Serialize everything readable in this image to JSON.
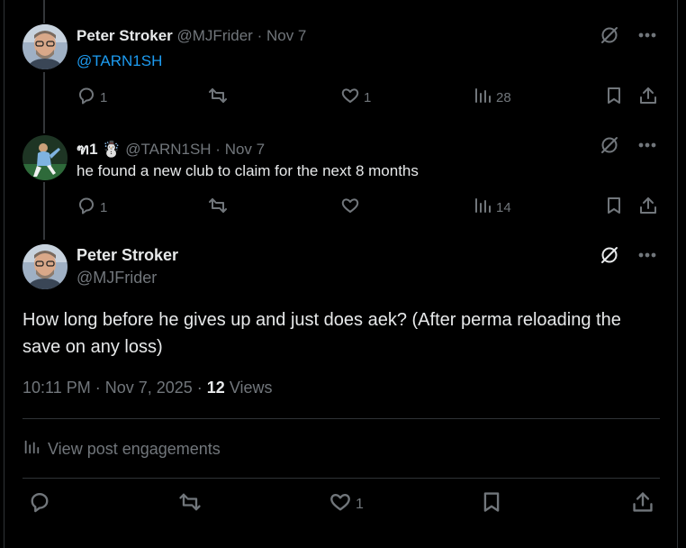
{
  "posts": [
    {
      "name": "Peter Stroker",
      "handle": "@MJFrider",
      "sep": "·",
      "date": "Nov 7",
      "text_mention": "@TARN1SH",
      "replies": "1",
      "reposts": "",
      "likes": "1",
      "views": "28"
    },
    {
      "name": "ฑ1",
      "emoji": "☃️",
      "handle": "@TARN1SH",
      "sep": "·",
      "date": "Nov 7",
      "text": "he found a new club to claim for the next 8 months",
      "replies": "1",
      "reposts": "",
      "likes": "",
      "views": "14"
    }
  ],
  "main": {
    "name": "Peter Stroker",
    "handle": "@MJFrider",
    "text": "How long before he gives up and just does aek? (After perma reloading the save on any loss)",
    "timestamp": "10:11 PM · Nov 7, 2025 ·",
    "views_count": "12",
    "views_label": "Views",
    "engagements_label": "View post engagements",
    "likes": "1"
  },
  "icons": {
    "grok": "grok-icon",
    "more": "more-icon",
    "reply": "reply-icon",
    "repost": "repost-icon",
    "like": "heart-icon",
    "views": "views-icon",
    "bookmark": "bookmark-icon",
    "share": "share-icon"
  },
  "colors": {
    "background": "#000000",
    "text": "#e7e9ea",
    "muted": "#71767b",
    "link": "#1d9bf0",
    "border": "#2f3336"
  }
}
